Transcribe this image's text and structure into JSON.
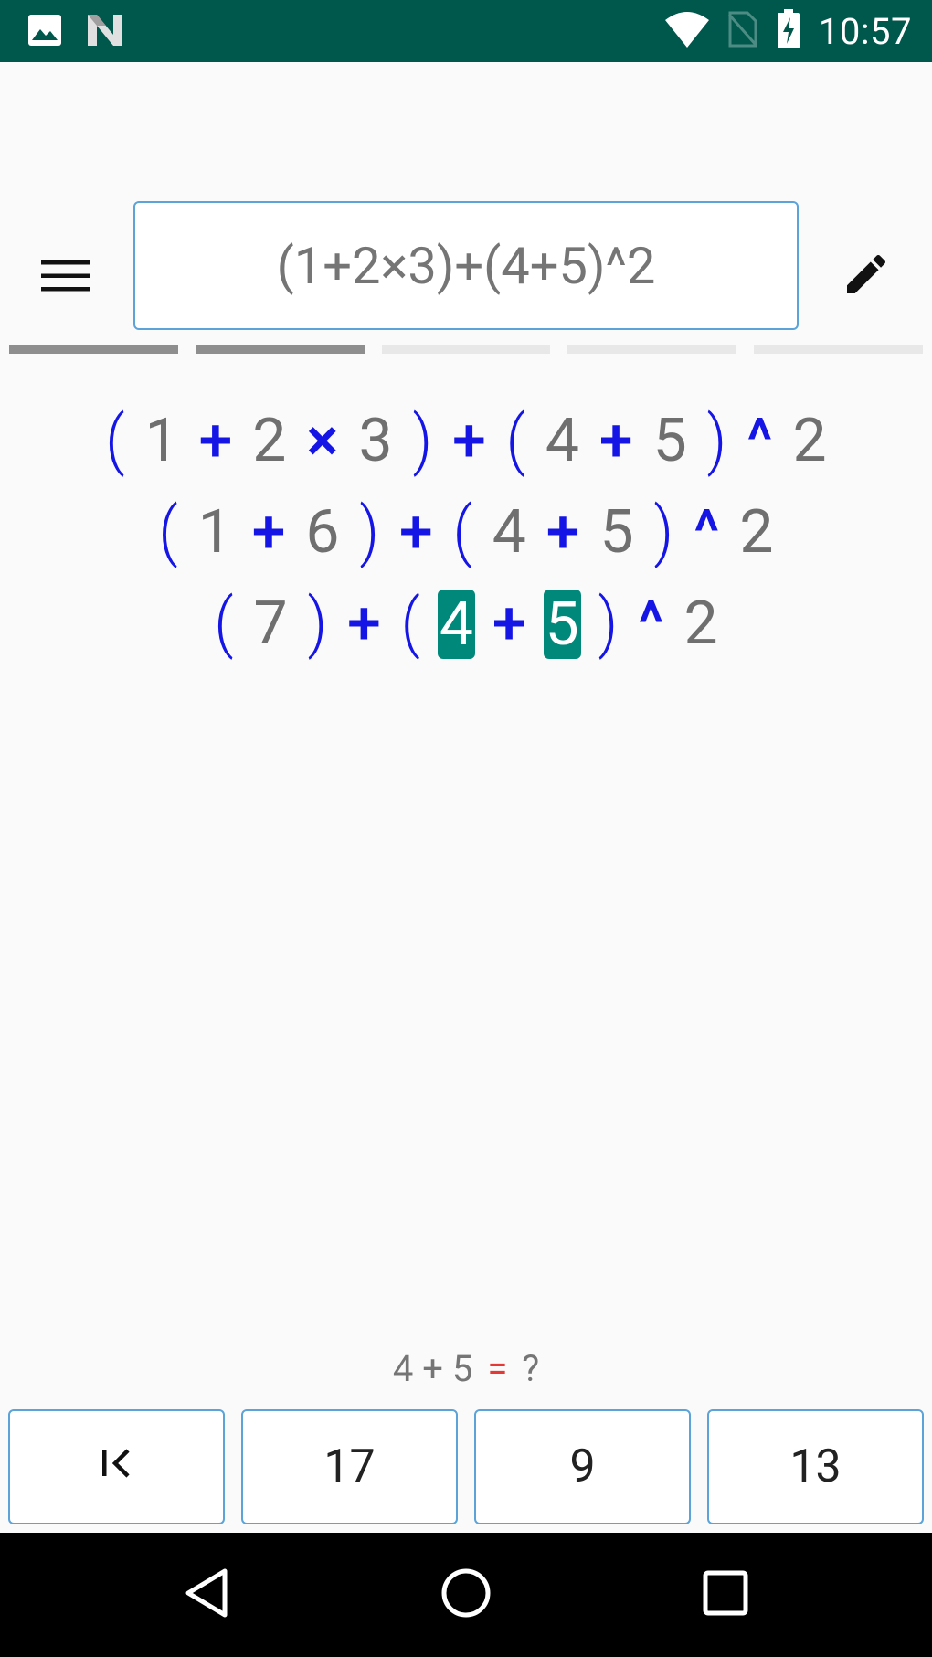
{
  "status_bar": {
    "time": "10:57",
    "icons": [
      "image-icon",
      "n-logo-icon",
      "wifi-icon",
      "no-sim-icon",
      "battery-charging-icon"
    ]
  },
  "toolbar": {
    "menu_icon": "hamburger-menu-icon",
    "expression": "(1+2×3)+(4+5)^2",
    "edit_icon": "pencil-icon"
  },
  "progress": {
    "total_segments": 5,
    "completed_segments": 2
  },
  "steps": [
    [
      "(",
      "1",
      "+",
      "2",
      "×",
      "3",
      ")",
      "+",
      "(",
      "4",
      "+",
      "5",
      ")",
      "^",
      "2"
    ],
    [
      "(",
      "1",
      "+",
      "6",
      ")",
      "+",
      "(",
      "4",
      "+",
      "5",
      ")",
      "^",
      "2"
    ],
    [
      "(",
      "7",
      ")",
      "+",
      "(",
      "4",
      "+",
      "5",
      ")",
      "^",
      "2"
    ]
  ],
  "question": {
    "left": "4 + 5",
    "equals": "=",
    "right": "?"
  },
  "answers": {
    "back_label": "K<",
    "options": [
      "17",
      "9",
      "13"
    ]
  },
  "nav_bar": {
    "back_icon": "back-triangle-icon",
    "home_icon": "home-circle-icon",
    "recents_icon": "recents-square-icon"
  },
  "colors": {
    "status_bar": "#00574b",
    "operator": "#1515e6",
    "number": "#6f6f6f",
    "highlight": "#00897b",
    "button_border": "#5ba3d8",
    "equals_sign": "#e53935"
  }
}
